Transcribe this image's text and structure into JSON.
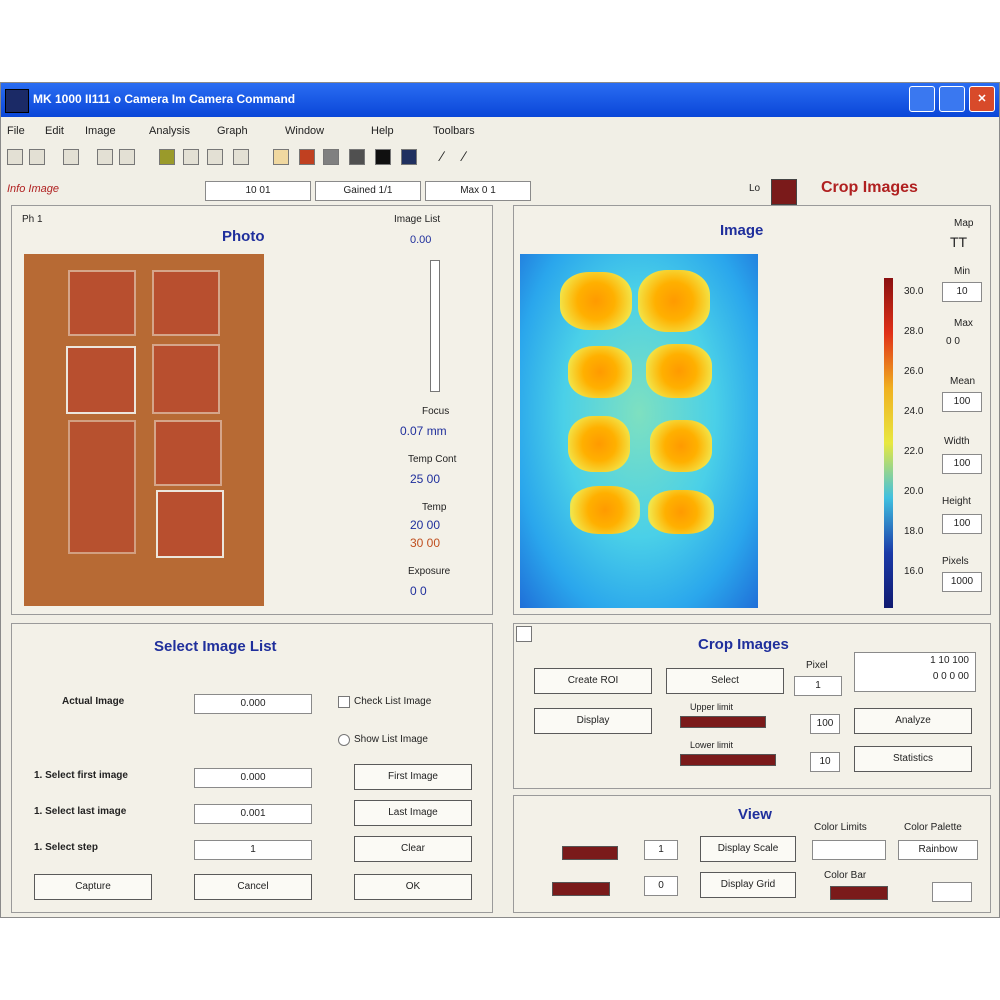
{
  "window": {
    "title": "MK 1000 II111  o Camera Im Camera Command",
    "accent": "#0a46d8"
  },
  "menu": [
    "File",
    "Edit",
    "Image",
    "Analysis",
    "Graph",
    "Window",
    "Help",
    "Toolbars"
  ],
  "toolbar_icons": [
    "save-icon",
    "open-icon",
    "copy-icon",
    "paste-icon",
    "cut-icon",
    "image-icon",
    "zoom-icon",
    "text-icon",
    "grid-icon",
    "graph-icon",
    "color-icon",
    "gray-icon",
    "black-icon",
    "stop-icon",
    "play-icon",
    "line-icon",
    "pencil-icon"
  ],
  "info": {
    "logo_text": "Info Image",
    "fields": [
      "10 01",
      "Gained 1/1",
      "Max 0 1"
    ],
    "crop_label": "Crop Images",
    "color_label": "Lo"
  },
  "photo": {
    "title": "Photo",
    "corner_label": "Ph 1",
    "image_list_label": "Image List",
    "image_list_value": "0.00",
    "sections": [
      {
        "label": "Focus",
        "value": "0.07 mm"
      },
      {
        "label": "Temp Cont",
        "value": "25 00"
      },
      {
        "label": "Temp",
        "value": "20 00",
        "value2": "30 00"
      },
      {
        "label": "Exposure",
        "value": "0 0"
      }
    ]
  },
  "image": {
    "title": "Image",
    "scale_labels": [
      "30.0",
      "28.0",
      "26.0",
      "24.0",
      "22.0",
      "20.0",
      "18.0",
      "16.0"
    ],
    "side": [
      {
        "label": "Map",
        "value": "TT"
      },
      {
        "label": "Min",
        "value": "10"
      },
      {
        "label": "Max",
        "value": "0 0"
      },
      {
        "label": "Mean",
        "value": "100"
      },
      {
        "label": "Width",
        "value": "100"
      },
      {
        "label": "Height",
        "value": "100"
      },
      {
        "label": "Pixels",
        "value": "1000"
      }
    ]
  },
  "select_list": {
    "title": "Select Image List",
    "active_label": "Actual Image",
    "active_value": "0.000",
    "check1": "Check List Image",
    "check2": "Show List Image",
    "rows": [
      {
        "label": "1. Select first image",
        "value": "0.000",
        "button": "First Image"
      },
      {
        "label": "1. Select last image",
        "value": "0.001",
        "button": "Last Image"
      },
      {
        "label": "1. Select step",
        "value": "1",
        "button": "Clear"
      }
    ],
    "bottom": [
      "Capture",
      "Cancel",
      "OK"
    ]
  },
  "crop": {
    "title": "Crop Images",
    "btn1": "Create ROI",
    "btn2": "Select",
    "btn3": "Display",
    "btn4": "Analyze",
    "btn5": "Statistics",
    "pixel_label": "Pixel",
    "pixel_value": "1",
    "slider1": "Upper limit",
    "slider2": "Lower limit",
    "value1": "100",
    "value2": "10",
    "coords": [
      "1 10 100",
      "0 0 0 00"
    ]
  },
  "view": {
    "title": "View",
    "btn1": "Display Scale",
    "btn2": "Display Grid",
    "label1": "Color Limits",
    "label2": "Color Palette",
    "label3": "Color Bar",
    "value1": "1",
    "value2": "0",
    "palette_value": "Rainbow"
  },
  "accent_color": "#7a1a1a"
}
